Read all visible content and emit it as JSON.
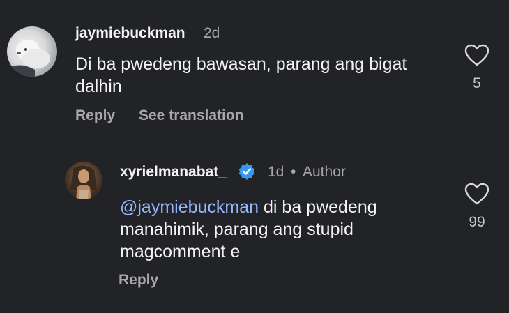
{
  "comments": [
    {
      "username": "jaymiebuckman",
      "time": "2d",
      "text_line1": "Di ba pwedeng bawasan, parang ang bigat",
      "text_line2": "dalhin",
      "actions": {
        "reply": "Reply",
        "translate": "See translation"
      },
      "like_count": "5"
    },
    {
      "username": "xyrielmanabat_",
      "time": "1d",
      "separator": "•",
      "author_badge": "Author",
      "mention": "@jaymiebuckman",
      "text_after_mention": " di ba pwedeng",
      "text_line2": "manahimik, parang ang stupid",
      "text_line3": "magcomment e",
      "actions": {
        "reply": "Reply"
      },
      "like_count": "99"
    }
  ],
  "icons": {
    "like": "heart-outline-icon",
    "verified": "verified-badge-icon"
  },
  "colors": {
    "background": "#222327",
    "mention": "#96b7ff",
    "verified": "#3797f0",
    "secondary_text": "#a8a8ac"
  }
}
